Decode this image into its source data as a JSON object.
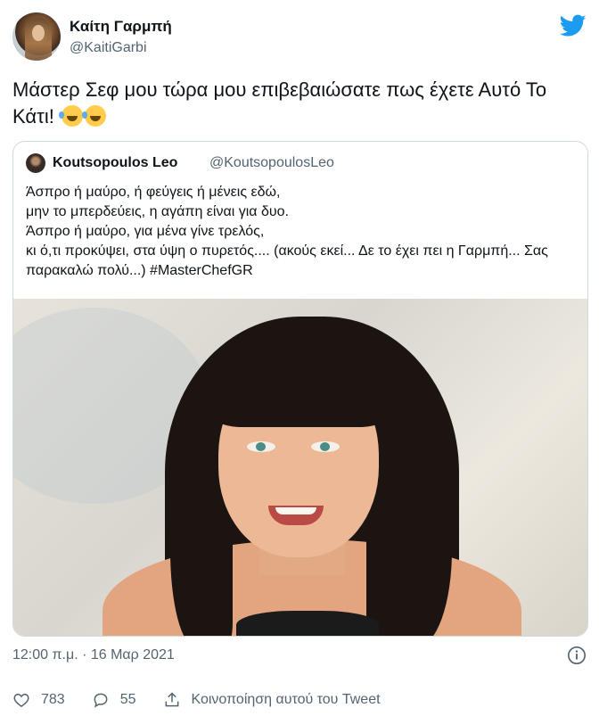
{
  "author": {
    "name": "Καίτη Γαρμπή",
    "handle": "@KaitiGarbi"
  },
  "tweet": {
    "text": "Μάστερ Σεφ μου τώρα μου επιβεβαιώσατε πως έχετε Αυτό Το Κάτι!",
    "emojis": [
      "rolling-on-floor-laughing",
      "rolling-on-floor-laughing"
    ]
  },
  "quoted": {
    "name": "Koutsopoulos Leo",
    "handle": "@KoutsopoulosLeo",
    "text": "Άσπρο ή μαύρο, ή φεύγεις ή μένεις εδώ,\nμην το μπερδεύεις, η αγάπη είναι για δυο.\nΆσπρο ή μαύρο, για μένα γίνε τρελός,\nκι ό,τι προκύψει, στα ύψη ο πυρετός.... (ακούς εκεί... Δε το έχει πει η Γαρμπή... Σας παρακαλώ πολύ...) #MasterChefGR"
  },
  "timestamp": "12:00 π.μ. · 16 Μαρ 2021",
  "actions": {
    "likes": "783",
    "replies": "55",
    "share_label": "Κοινοποίηση αυτού του Tweet"
  },
  "colors": {
    "twitter_blue": "#1d9bf0",
    "text": "#0f1419",
    "secondary": "#536471",
    "border": "#cfd9de"
  }
}
